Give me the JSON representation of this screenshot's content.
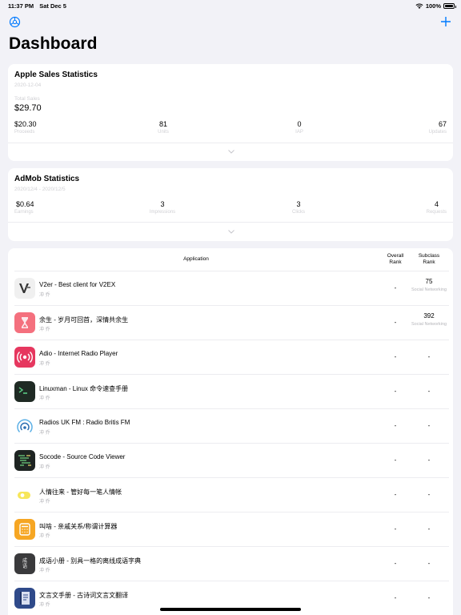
{
  "status_bar": {
    "time": "11:37 PM",
    "date": "Sat Dec 5",
    "battery": "100%"
  },
  "page": {
    "title": "Dashboard"
  },
  "apple": {
    "title": "Apple Sales Statistics",
    "date": "2020-12-04",
    "total_label": "Total Sales",
    "total_value": "$29.70",
    "stats": [
      {
        "value": "$20.30",
        "label": "Proceeds"
      },
      {
        "value": "81",
        "label": "Units"
      },
      {
        "value": "0",
        "label": "IAP"
      },
      {
        "value": "67",
        "label": "Updates"
      }
    ]
  },
  "admob": {
    "title": "AdMob Statistics",
    "date": "2020/12/4 - 2020/12/5",
    "stats": [
      {
        "value": "$0.64",
        "label": "Earnings"
      },
      {
        "value": "3",
        "label": "Impressions"
      },
      {
        "value": "3",
        "label": "Clicks"
      },
      {
        "value": "4",
        "label": "Requests"
      }
    ]
  },
  "table": {
    "col_app": "Application",
    "col_overall": "Overall Rank",
    "col_subclass": "Subclass Rank",
    "rows": [
      {
        "name": "V2er - Best client for V2EX",
        "dev": "冲 乔",
        "overall": "-",
        "sub": "75",
        "category": "Social Networking",
        "icon": "v2er-icon"
      },
      {
        "name": "余生 - 岁月可回首，深情共余生",
        "dev": "冲 乔",
        "overall": "-",
        "sub": "392",
        "category": "Social Networking",
        "icon": "hourglass-icon"
      },
      {
        "name": "Adio - Internet Radio Player",
        "dev": "冲 乔",
        "overall": "-",
        "sub": "-",
        "category": "",
        "icon": "radio-icon"
      },
      {
        "name": "Linuxman - Linux 命令速查手册",
        "dev": "冲 乔",
        "overall": "-",
        "sub": "-",
        "category": "",
        "icon": "terminal-icon"
      },
      {
        "name": "Radios UK FM : Radio Britis FM",
        "dev": "冲 乔",
        "overall": "-",
        "sub": "-",
        "category": "",
        "icon": "broadcast-icon"
      },
      {
        "name": "Socode - Source Code Viewer",
        "dev": "冲 乔",
        "overall": "-",
        "sub": "-",
        "category": "",
        "icon": "code-icon"
      },
      {
        "name": "人情往来 - 管好每一笔人情帐",
        "dev": "冲 乔",
        "overall": "-",
        "sub": "-",
        "category": "",
        "icon": "ticket-icon"
      },
      {
        "name": "叫啥 - 亲戚关系/称谓计算器",
        "dev": "冲 乔",
        "overall": "-",
        "sub": "-",
        "category": "",
        "icon": "calculator-icon"
      },
      {
        "name": "成语小册 - 别具一格的离线成语字典",
        "dev": "冲 乔",
        "overall": "-",
        "sub": "-",
        "category": "",
        "icon": "idiom-icon",
        "icon_text": "成语"
      },
      {
        "name": "文言文手册 - 古诗词文言文翻译",
        "dev": "冲 乔",
        "overall": "-",
        "sub": "-",
        "category": "",
        "icon": "book-icon"
      }
    ]
  },
  "colors": {
    "accent": "#007aff",
    "background": "#f2f2f7"
  }
}
